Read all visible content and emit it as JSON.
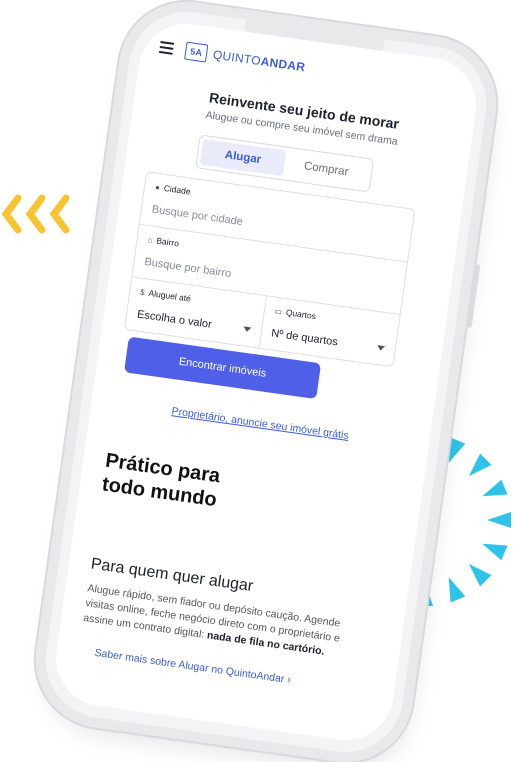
{
  "brand": {
    "logo_mark": "5A",
    "name_prefix": "QUINTO",
    "name_suffix": "ANDAR"
  },
  "hero": {
    "title": "Reinvente seu jeito de morar",
    "subtitle": "Alugue ou compre seu imóvel sem drama"
  },
  "mode_toggle": {
    "rent": "Alugar",
    "buy": "Comprar",
    "selected": "Alugar"
  },
  "form": {
    "city": {
      "label": "Cidade",
      "placeholder": "Busque por cidade"
    },
    "neighborhood": {
      "label": "Bairro",
      "placeholder": "Busque por bairro"
    },
    "max_rent": {
      "label": "Aluguel até",
      "value": "Escolha o valor"
    },
    "bedrooms": {
      "label": "Quartos",
      "value": "Nº de quartos"
    }
  },
  "cta_label": "Encontrar imóveis",
  "owner_link": "Proprietário, anuncie seu imóvel grátis",
  "section": {
    "title_line1": "Prático para",
    "title_line2": "todo mundo"
  },
  "rent_block": {
    "title": "Para quem quer alugar",
    "text": "Alugue rápido, sem fiador ou depósito caução. Agende visitas online, feche negócio direto com o proprietário e assine um contrato digital: ",
    "text_bold": "nada de fila no cartório.",
    "link": "Saber mais sobre Alugar no QuintoAndar ›"
  },
  "colors": {
    "accent": "#4f5fe8",
    "yellow": "#f7c531",
    "cyan": "#2fc3ea"
  },
  "icons": [
    "menu-icon",
    "location-pin-icon",
    "home-icon",
    "dollar-icon",
    "bed-icon",
    "chevron-down-icon",
    "chevron-right-icon"
  ]
}
